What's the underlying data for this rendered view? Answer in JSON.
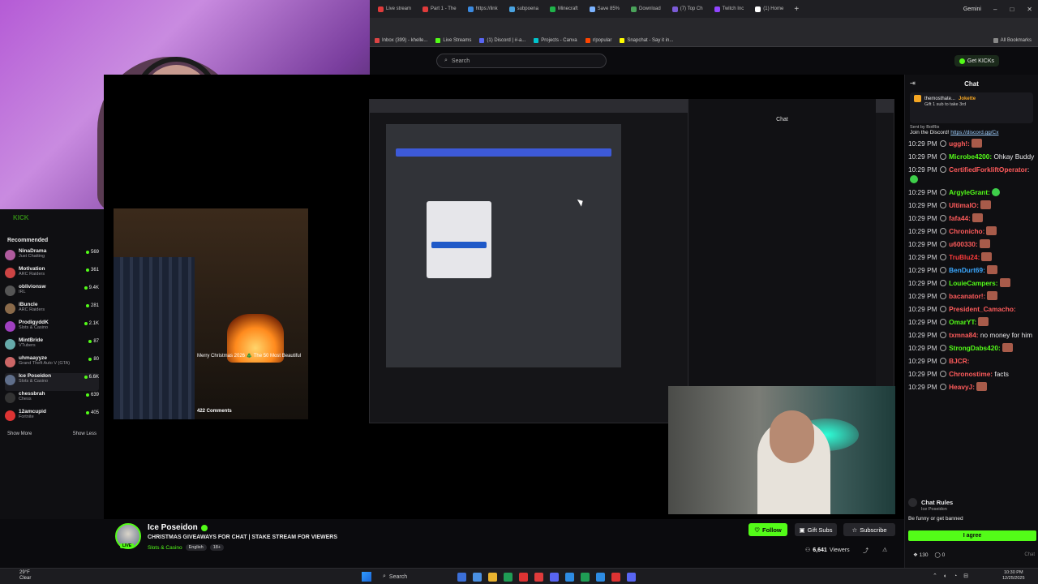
{
  "browser": {
    "tabs": [
      {
        "label": "Live stream",
        "color": "#e03b3b"
      },
      {
        "label": "Part 1 - The",
        "color": "#e03b3b"
      },
      {
        "label": "https://link",
        "color": "#3b8ae0"
      },
      {
        "label": "subpoena",
        "color": "#4aa3e0"
      },
      {
        "label": "Minecraft",
        "color": "#1fb34a"
      },
      {
        "label": "Save 85%",
        "color": "#7bb3ff"
      },
      {
        "label": "Download",
        "color": "#4aa35a"
      },
      {
        "label": "(7) Top Ch",
        "color": "#7b5bd6"
      },
      {
        "label": "Twitch Inc",
        "color": "#9146ff"
      },
      {
        "label": "(1) Home",
        "color": "#ffffff"
      }
    ],
    "gemini_label": "Gemini",
    "bookmarks": [
      {
        "label": "Inbox (399) - khelle...",
        "color": "#d44"
      },
      {
        "label": "Live Streams",
        "color": "#53fc18"
      },
      {
        "label": "(1) Discord | #-a...",
        "color": "#5865f2"
      },
      {
        "label": "Projects - Canva",
        "color": "#00c4cc"
      },
      {
        "label": "r/popular",
        "color": "#ff4500"
      },
      {
        "label": "Snapchat - Say it in...",
        "color": "#fffc00"
      }
    ],
    "all_bookmarks": "All Bookmarks"
  },
  "header": {
    "search_placeholder": "Search",
    "get_kicks": "Get KICKs"
  },
  "sidebar": {
    "logo": "KICK",
    "title": "Recommended",
    "items": [
      {
        "name": "NinaDrama",
        "category": "Just Chatting",
        "viewers": "569",
        "color": "#b05b9e"
      },
      {
        "name": "Motivation",
        "category": "ARC Raiders",
        "viewers": "361",
        "color": "#c44"
      },
      {
        "name": "oblivionsw",
        "category": "IRL",
        "viewers": "9.4K",
        "color": "#555"
      },
      {
        "name": "iBuncle",
        "category": "ARC Raiders",
        "viewers": "281",
        "color": "#8a6a4a"
      },
      {
        "name": "ProdigyddK",
        "category": "Slots & Casino",
        "viewers": "2.1K",
        "color": "#a040c0"
      },
      {
        "name": "MintBride",
        "category": "VTubers",
        "viewers": "87",
        "color": "#6aa"
      },
      {
        "name": "uhmaayyze",
        "category": "Grand Theft Auto V (GTA)",
        "viewers": "80",
        "color": "#c66"
      },
      {
        "name": "Ice Poseidon",
        "category": "Slots & Casino",
        "viewers": "6.6K",
        "color": "#5f6e8a"
      },
      {
        "name": "chessbrah",
        "category": "Chess",
        "viewers": "639",
        "color": "#333"
      },
      {
        "name": "12amcupid",
        "category": "Fortnite",
        "viewers": "405",
        "color": "#d33"
      }
    ],
    "show_more": "Show More",
    "show_less": "Show Less"
  },
  "stream": {
    "video_caption": "Merry Christmas 2026 🎄 The 50 Most Beautiful",
    "comments": "422 Comments",
    "chat_title": "Chat"
  },
  "chat": {
    "title": "Chat",
    "pinned": {
      "name": "Jokette",
      "badge": "themosthate...",
      "text": "Gift 1 sub to take 3rd"
    },
    "bot": {
      "sent_by": "Sent by",
      "bot_name": "BotRix",
      "text": "Join the Discord!",
      "link": "https://discord.gg/Cx"
    },
    "messages": [
      {
        "time": "10:29 PM",
        "user": "uggh!:",
        "color": "#ff5b5b",
        "text": "",
        "emote": "red"
      },
      {
        "time": "10:29 PM",
        "user": "Microbe4200:",
        "color": "#53fc18",
        "text": " Ohkay Buddy",
        "emote": ""
      },
      {
        "time": "10:29 PM",
        "user": "CertifiedForkliftOperator",
        "color": "#ff5b5b",
        "text": ":",
        "emote": "g"
      },
      {
        "time": "10:29 PM",
        "user": "ArgyleGrant:",
        "color": "#53fc18",
        "text": "",
        "emote": "g"
      },
      {
        "time": "10:29 PM",
        "user": "UltimaIO:",
        "color": "#ff5b5b",
        "text": "",
        "emote": "red"
      },
      {
        "time": "10:29 PM",
        "user": "fafa44:",
        "color": "#ff5b5b",
        "text": "",
        "emote": "red"
      },
      {
        "time": "10:29 PM",
        "user": "Chronicho:",
        "color": "#ff5b5b",
        "text": "",
        "emote": "red"
      },
      {
        "time": "10:29 PM",
        "user": "u600330:",
        "color": "#ff5b5b",
        "text": "",
        "emote": "red"
      },
      {
        "time": "10:29 PM",
        "user": "TruBlu24:",
        "color": "#ff3b3b",
        "text": "",
        "emote": "red"
      },
      {
        "time": "10:29 PM",
        "user": "BenDurt69:",
        "color": "#3ba8ff",
        "text": "",
        "emote": "red"
      },
      {
        "time": "10:29 PM",
        "user": "LouieCampers:",
        "color": "#53fc18",
        "text": "",
        "emote": "red"
      },
      {
        "time": "10:29 PM",
        "user": "bacanator!:",
        "color": "#ff5b5b",
        "text": "",
        "emote": "red"
      },
      {
        "time": "10:29 PM",
        "user": "President_Camacho:",
        "color": "#ff5b5b",
        "text": "",
        "emote": ""
      },
      {
        "time": "10:29 PM",
        "user": "OmarYT:",
        "color": "#53fc18",
        "text": "",
        "emote": "red"
      },
      {
        "time": "10:29 PM",
        "user": "txmna84:",
        "color": "#ff5b5b",
        "text": " no money for him",
        "emote": ""
      },
      {
        "time": "10:29 PM",
        "user": "StrongDabs420:",
        "color": "#53fc18",
        "text": "",
        "emote": "red"
      },
      {
        "time": "10:29 PM",
        "user": "BJCR:",
        "color": "#ff5b5b",
        "text": "",
        "emote": ""
      },
      {
        "time": "10:29 PM",
        "user": "Chronostime:",
        "color": "#ff5b5b",
        "text": " facts",
        "emote": ""
      },
      {
        "time": "10:29 PM",
        "user": "HeavyJ:",
        "color": "#ff5b5b",
        "text": "",
        "emote": "red"
      }
    ],
    "rules_title": "Chat Rules",
    "rules_sub": "Ice Poseidon",
    "rules_text": "Be funny or get banned",
    "agree": "I agree",
    "kicks": "130",
    "emote_count": "0",
    "send": "Chat"
  },
  "streamer": {
    "name": "Ice Poseidon",
    "live": "LIVE",
    "title": "CHRISTMAS GIVEAWAYS FOR CHAT | STAKE STREAM FOR VIEWERS",
    "category": "Slots & Casino",
    "tags": [
      "English",
      "18+"
    ],
    "follow": "Follow",
    "gift_subs": "Gift Subs",
    "subscribe": "Subscribe",
    "viewers": "6,641",
    "viewers_label": "Viewers"
  },
  "taskbar": {
    "temp": "29°F",
    "weather": "Clear",
    "search": "Search",
    "time": "10:30 PM",
    "date": "12/25/2025",
    "apps": [
      "#3b6fd8",
      "#4a90e2",
      "#e9b330",
      "#1f9d55",
      "#d33",
      "#e03b3b",
      "#5865f2",
      "#2d8ce3",
      "#1f9d55",
      "#2d8ce3",
      "#d33",
      "#5865f2"
    ]
  }
}
